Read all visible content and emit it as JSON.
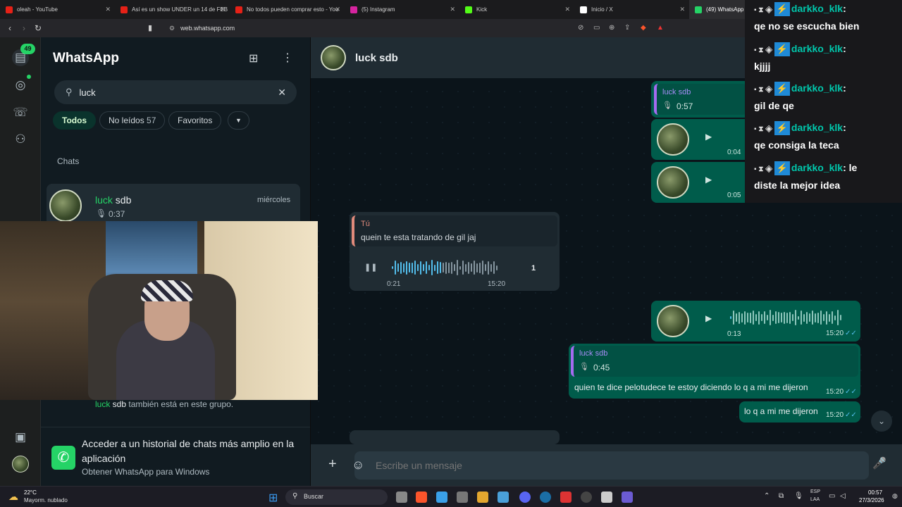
{
  "browser": {
    "tabs": [
      {
        "title": "oleah - YouTube",
        "color": "#e62117"
      },
      {
        "title": "Así es un show UNDER un 14 de FEB",
        "color": "#e62117"
      },
      {
        "title": "No todos pueden comprar esto - You",
        "color": "#e62117"
      },
      {
        "title": "(5) Instagram",
        "color": "#d6249f"
      },
      {
        "title": "Kick",
        "color": "#53fc18"
      },
      {
        "title": "Inicio / X",
        "color": "#ffffff"
      },
      {
        "title": "(49) WhatsApp",
        "color": "#25d366"
      }
    ],
    "url": "web.whatsapp.com"
  },
  "sidebar": {
    "unread_badge": "49",
    "title": "WhatsApp",
    "search_value": "luck",
    "filters": [
      {
        "label": "Todos",
        "active": true
      },
      {
        "label": "No leídos",
        "count": "57"
      },
      {
        "label": "Favoritos"
      }
    ],
    "section_label": "Chats",
    "chat": {
      "name_highlight": "luck",
      "name_rest": " sdb",
      "preview": "0:37",
      "date": "miércoles"
    },
    "group_note_highlight": "luck",
    "group_note_name": " sdb",
    "group_note_rest": " también está en este grupo.",
    "promo_title": "Acceder a un historial de chats más amplio en la aplicación",
    "promo_subtitle": "Obtener WhatsApp para Windows"
  },
  "conversation": {
    "contact_name": "luck sdb",
    "quote1": {
      "author": "luck sdb",
      "duration": "0:57"
    },
    "voice_top1_duration": "0:04",
    "voice_top2_duration": "0:05",
    "in_quote": {
      "author": "Tú",
      "text": "quein te esta tratando de gil jaj"
    },
    "in_voice": {
      "elapsed": "0:21",
      "time": "15:20",
      "speed": "1",
      "progress": 0.45
    },
    "out_voice": {
      "duration": "0:13",
      "time": "15:20"
    },
    "reply_msg": {
      "quote_author": "luck sdb",
      "quote_duration": "0:45",
      "text": "quien te dice pelotudece te estoy diciendo lo q a mi me dijeron",
      "time": "15:20"
    },
    "short_msg": {
      "text": "lo q a mi me dijeron",
      "time": "15:20"
    },
    "composer_placeholder": "Escribe un mensaje"
  },
  "stream_chat": [
    {
      "user": "darkko_klk",
      "text": "qe no se escucha bien"
    },
    {
      "user": "darkko_klk",
      "text": "kjjjj"
    },
    {
      "user": "darkko_klk",
      "text": "gil de qe"
    },
    {
      "user": "darkko_klk",
      "text": "qe consiga la teca"
    },
    {
      "user": "darkko_klk",
      "text_inline": "le",
      "text": "diste la mejor idea"
    }
  ],
  "taskbar": {
    "weather_temp": "22°C",
    "weather_desc": "Mayorm. nublado",
    "search_label": "Buscar",
    "lang": "ESP",
    "lang2": "LAA",
    "time": "00:57",
    "date": "27/3/2026"
  }
}
